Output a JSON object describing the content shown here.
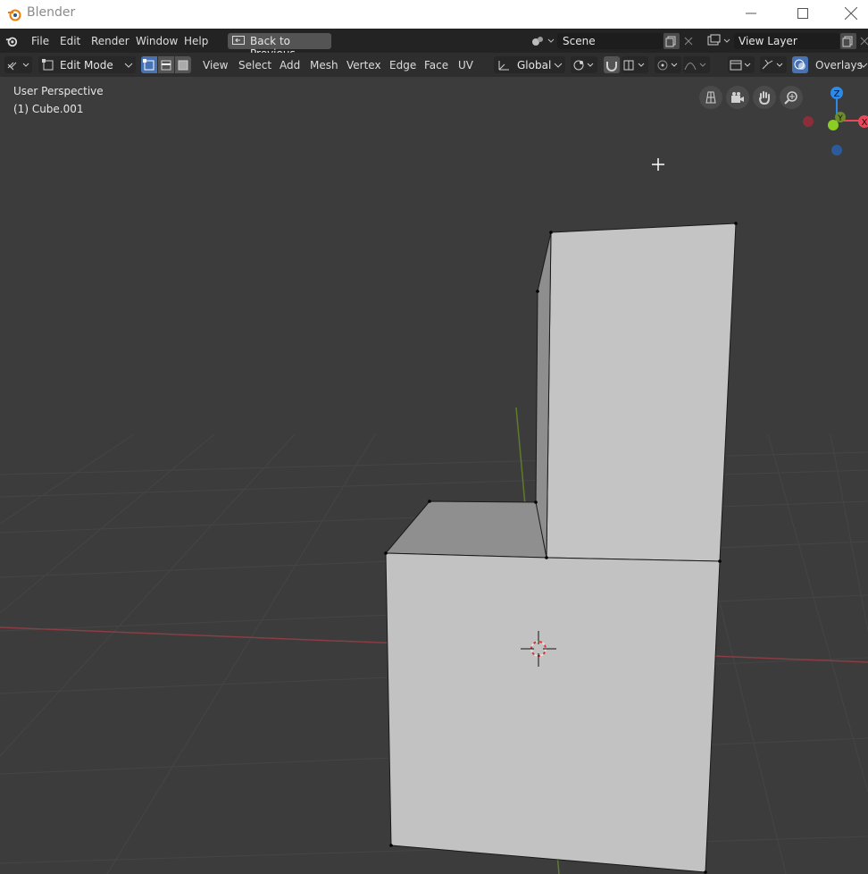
{
  "window": {
    "title": "Blender"
  },
  "menubar": {
    "items": [
      "File",
      "Edit",
      "Render",
      "Window",
      "Help"
    ],
    "back_button": "Back to Previous",
    "scene": "Scene",
    "view_layer": "View Layer"
  },
  "toolbar": {
    "mode": "Edit Mode",
    "menus": [
      "View",
      "Select",
      "Add",
      "Mesh",
      "Vertex",
      "Edge",
      "Face",
      "UV"
    ],
    "transform_orientation": "Global",
    "overlays": "Overlays"
  },
  "viewport": {
    "perspective": "User Perspective",
    "object": "(1) Cube.001",
    "gizmo_axes": {
      "z": "Z",
      "y": "Y",
      "x": "X"
    }
  },
  "colors": {
    "accent": "#4772b3",
    "x_axis": "#e8485a",
    "y_axis": "#8ccd24",
    "z_axis": "#2d8ae8"
  }
}
